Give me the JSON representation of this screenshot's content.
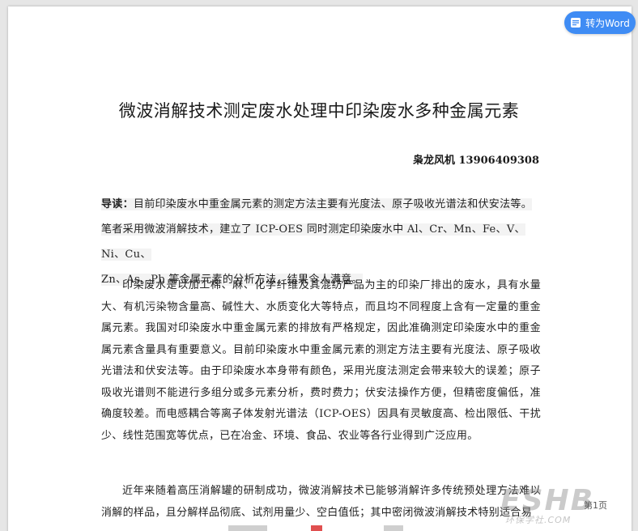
{
  "toolbar": {
    "to_word_label": "转为Word",
    "icon": "word-icon"
  },
  "document": {
    "title": "微波消解技术测定废水处理中印染废水多种金属元素",
    "author_line": "枭龙风机 13906409308",
    "intro_label": "导读：",
    "intro_line1": "目前印染废水中重金属元素的测定方法主要有光度法、原子吸收光谱法和伏安法等。",
    "intro_line2": "笔者采用微波消解技术，建立了 ICP-OES 同时测定印染废水中 Al、Cr、Mn、Fe、V、Ni、Cu、",
    "intro_line3": "Zn、As、Pb 等金属元素的分析方法，结果令人满意。",
    "paragraph1": "印染废水是以加工棉、麻、化学纤维及其混纺产品为主的印染厂排出的废水，具有水量大、有机污染物含量高、碱性大、水质变化大等特点，而且均不同程度上含有一定量的重金属元素。我国对印染废水中重金属元素的排放有严格规定，因此准确测定印染废水中的重金属元素含量具有重要意义。目前印染废水中重金属元素的测定方法主要有光度法、原子吸收光谱法和伏安法等。由于印染废水本身带有颜色，采用光度法测定会带来较大的误差；原子吸收光谱则不能进行多组分或多元素分析，费时费力；伏安法操作方便，但精密度偏低，准确度较差。而电感耦合等离子体发射光谱法（ICP-OES）因具有灵敏度高、检出限低、干扰少、线性范围宽等优点，已在冶金、环境、食品、农业等各行业得到广泛应用。",
    "paragraph2": "近年来随着高压消解罐的研制成功，微波消解技术已能够消解许多传统预处理方法难以消解的样品，且分解样品彻底、试剂用量少、空白值低；其中密闭微波消解技术特别适合易",
    "page_number": "第1页"
  },
  "watermark": {
    "main": "ESHB",
    "sub": "环保学社.COM"
  },
  "colors": {
    "accent": "#3f8cf4",
    "background": "#e6e6e6",
    "page": "#ffffff"
  }
}
